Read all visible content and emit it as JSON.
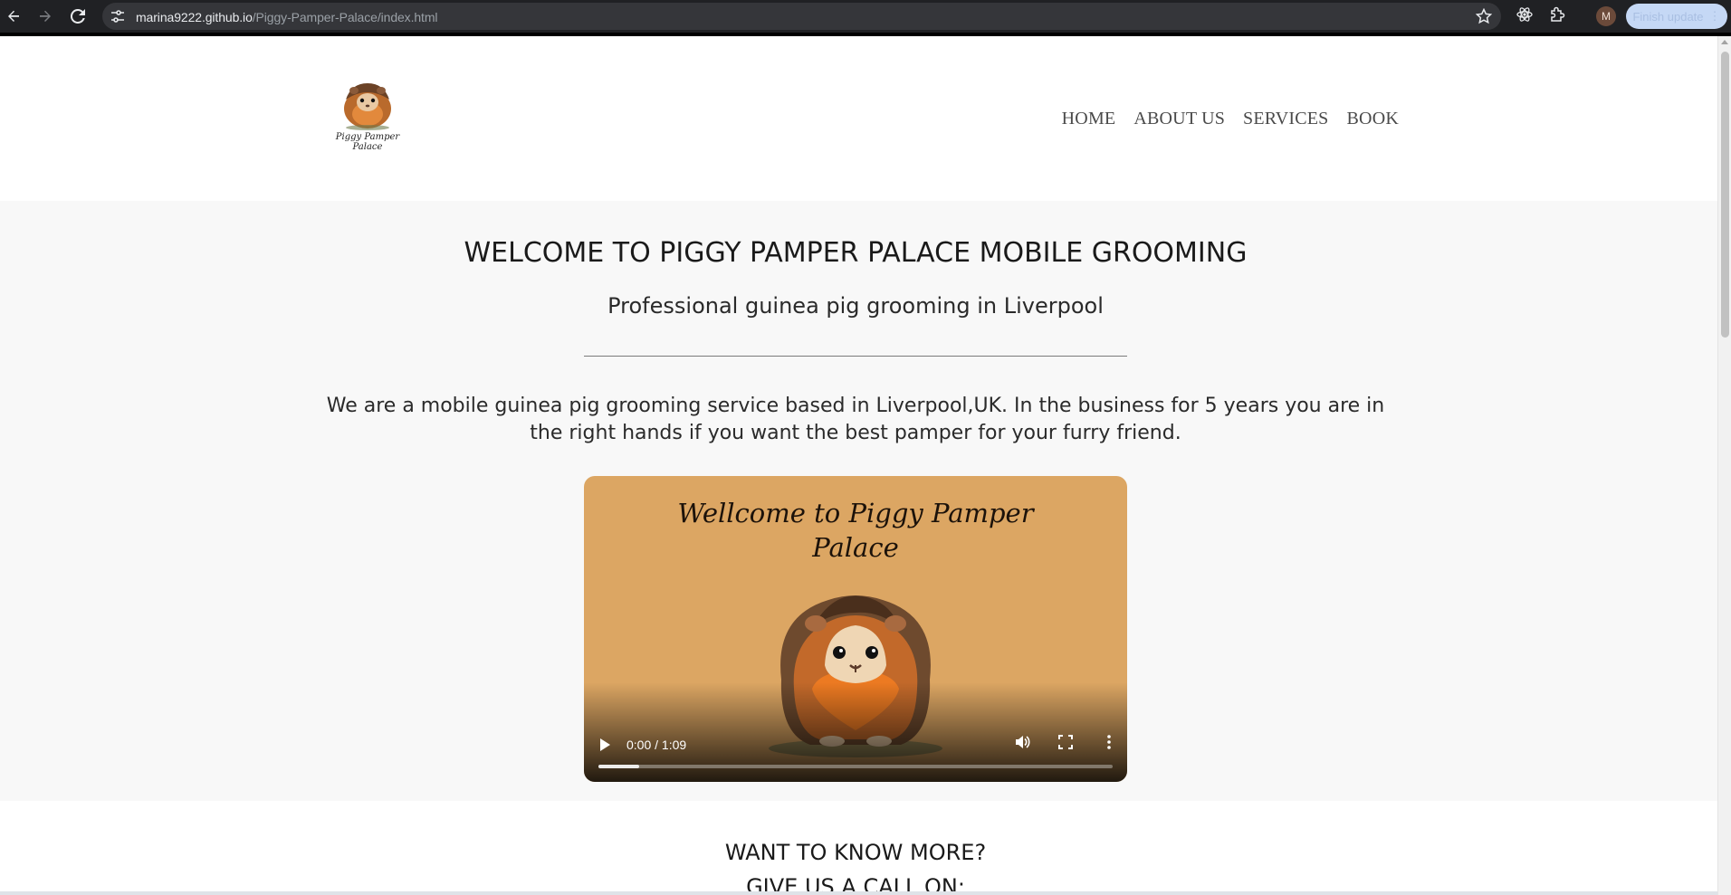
{
  "browser": {
    "url_host": "marina9222.github.io",
    "url_path": "/Piggy-Pamper-Palace/index.html",
    "avatar_initial": "M",
    "update_label": "Finish update"
  },
  "header": {
    "logo_text": "Piggy Pamper Palace",
    "nav": [
      "HOME",
      "ABOUT US",
      "SERVICES",
      "BOOK"
    ]
  },
  "hero": {
    "title": "WELCOME TO PIGGY PAMPER PALACE MOBILE GROOMING",
    "subtitle": "Professional guinea pig grooming in Liverpool",
    "intro": "We are a mobile guinea pig grooming service based in Liverpool,UK. In the business for 5 years you are in the right hands if you want the best pamper for your furry friend."
  },
  "video": {
    "title_line1": "Wellcome to Piggy Pamper",
    "title_line2": "Palace",
    "time": "0:00 / 1:09",
    "buffered_fraction": 0.08
  },
  "contact": {
    "heading": "WANT TO KNOW MORE?",
    "call": "GIVE US A CALL ON:"
  },
  "colors": {
    "page_bg": "#f8f8f8",
    "video_bg": "#dca663",
    "chrome": "#202124"
  }
}
